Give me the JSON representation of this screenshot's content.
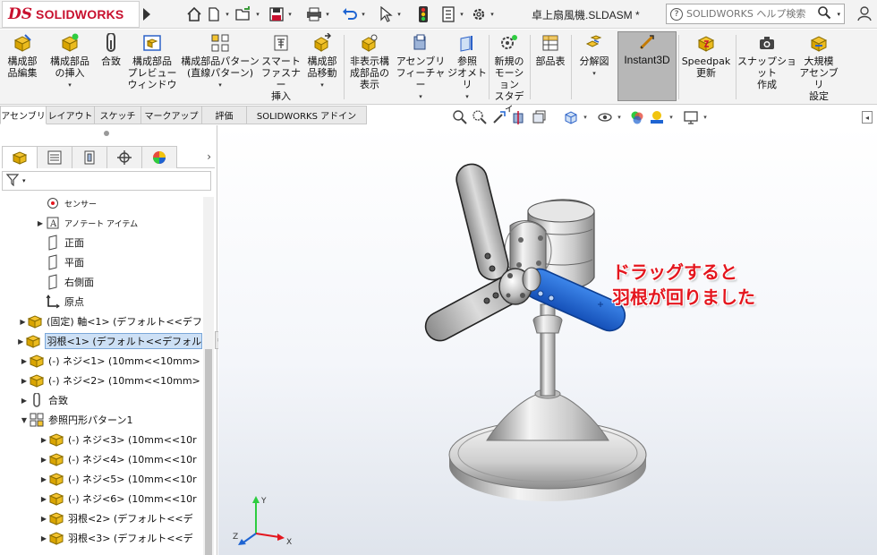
{
  "app": {
    "brand": "SOLIDWORKS",
    "logo_mark": "DS"
  },
  "document": {
    "title": "卓上扇風機.SLDASM *"
  },
  "help_search": {
    "placeholder": "SOLIDWORKS ヘルプ検索"
  },
  "quick_access": {
    "icons": [
      "home-icon",
      "new-document-icon",
      "open-icon",
      "save-icon",
      "print-icon",
      "undo-icon",
      "select-icon",
      "rebuild-icon",
      "file-properties-icon",
      "options-icon"
    ]
  },
  "command_manager": {
    "commands": [
      {
        "id": "edit-component",
        "label": "構成部\n品編集",
        "icon": "edit-component-icon"
      },
      {
        "id": "insert-components",
        "label": "構成部品\nの挿入",
        "icon": "insert-components-icon",
        "dropdown": true
      },
      {
        "id": "mate",
        "label": "合致",
        "icon": "mate-icon"
      },
      {
        "id": "component-preview",
        "label": "構成部品\nプレビュー\nウィンドウ",
        "icon": "component-preview-icon"
      },
      {
        "id": "linear-pattern",
        "label": "構成部品パターン\n(直線パターン)",
        "icon": "linear-pattern-icon",
        "dropdown": true
      },
      {
        "id": "smart-fasteners",
        "label": "スマート\nファスナー\n挿入",
        "icon": "smart-fasteners-icon"
      },
      {
        "id": "move-component",
        "label": "構成部\n品移動",
        "icon": "move-component-icon",
        "dropdown": true
      },
      {
        "id": "show-hidden",
        "label": "非表示構\n成部品の\n表示",
        "icon": "show-hidden-icon"
      },
      {
        "id": "assembly-features",
        "label": "アセンブリ\nフィーチャー",
        "icon": "assembly-features-icon",
        "dropdown": true
      },
      {
        "id": "reference-geometry",
        "label": "参照\nジオメトリ",
        "icon": "reference-geometry-icon",
        "dropdown": true
      },
      {
        "id": "new-motion-study",
        "label": "新規の\nモーション\nスタディ",
        "icon": "motion-study-icon"
      },
      {
        "id": "bill-of-materials",
        "label": "部品表",
        "icon": "bom-icon"
      },
      {
        "id": "exploded-view",
        "label": "分解図",
        "icon": "exploded-view-icon",
        "dropdown": true
      },
      {
        "id": "instant3d",
        "label": "Instant3D",
        "icon": "instant3d-icon",
        "pressed": true
      },
      {
        "id": "speedpak",
        "label": "Speedpak\n更新",
        "icon": "speedpak-icon"
      },
      {
        "id": "snapshot",
        "label": "スナップショット\n作成",
        "icon": "snapshot-icon"
      },
      {
        "id": "large-assembly",
        "label": "大規模\nアセンブリ\n設定",
        "icon": "large-assembly-icon"
      }
    ]
  },
  "tabs": [
    {
      "label": "アセンブリ",
      "active": true
    },
    {
      "label": "レイアウト"
    },
    {
      "label": "スケッチ"
    },
    {
      "label": "マークアップ"
    },
    {
      "label": "評価"
    },
    {
      "label": "SOLIDWORKS アドイン"
    }
  ],
  "panel_tabs": [
    "feature-manager-icon",
    "property-manager-icon",
    "configuration-manager-icon",
    "dimxpert-icon",
    "display-manager-icon"
  ],
  "feature_tree": {
    "nodes": [
      {
        "label": "センサー",
        "icon": "sensor-icon",
        "indent": 1,
        "small": true
      },
      {
        "label": "アノテート アイテム",
        "icon": "annotation-icon",
        "indent": 1,
        "expander": "▶",
        "small": true
      },
      {
        "label": "正面",
        "icon": "plane-icon",
        "indent": 1
      },
      {
        "label": "平面",
        "icon": "plane-icon",
        "indent": 1
      },
      {
        "label": "右側面",
        "icon": "plane-icon",
        "indent": 1
      },
      {
        "label": "原点",
        "icon": "origin-icon",
        "indent": 1
      },
      {
        "label": "(固定) 軸<1> (デフォルト<<デフォ",
        "icon": "part-icon",
        "indent": 0,
        "expander": "▶"
      },
      {
        "label": "羽根<1> (デフォルト<<デフォルト>_",
        "icon": "part-icon",
        "indent": 0,
        "expander": "▶",
        "selected": true
      },
      {
        "label": "(-) ネジ<1> (10mm<<10mm>",
        "icon": "part-icon",
        "indent": 0,
        "expander": "▶"
      },
      {
        "label": "(-) ネジ<2> (10mm<<10mm>",
        "icon": "part-icon",
        "indent": 0,
        "expander": "▶"
      },
      {
        "label": "合致",
        "icon": "mates-folder-icon",
        "indent": 0,
        "expander": "▶"
      },
      {
        "label": "参照円形パターン1",
        "icon": "circular-pattern-icon",
        "indent": 0,
        "expander": "▼"
      },
      {
        "label": "(-) ネジ<3> (10mm<<10r",
        "icon": "part-icon",
        "indent": 2,
        "expander": "▶"
      },
      {
        "label": "(-) ネジ<4> (10mm<<10r",
        "icon": "part-icon",
        "indent": 2,
        "expander": "▶"
      },
      {
        "label": "(-) ネジ<5> (10mm<<10r",
        "icon": "part-icon",
        "indent": 2,
        "expander": "▶"
      },
      {
        "label": "(-) ネジ<6> (10mm<<10r",
        "icon": "part-icon",
        "indent": 2,
        "expander": "▶"
      },
      {
        "label": "羽根<2> (デフォルト<<デ",
        "icon": "part-icon",
        "indent": 2,
        "expander": "▶"
      },
      {
        "label": "羽根<3> (デフォルト<<デ",
        "icon": "part-icon",
        "indent": 2,
        "expander": "▶"
      }
    ]
  },
  "viewport": {
    "annotation": "ドラッグすると\n羽根が回りました",
    "triad_labels": {
      "x": "X",
      "y": "Y",
      "z": "Z"
    }
  },
  "colors": {
    "accent_red": "#c8102e",
    "annotation_red": "#e4161e",
    "selected_blade": "#1e64d2",
    "tree_selection": "#cde0f5"
  }
}
